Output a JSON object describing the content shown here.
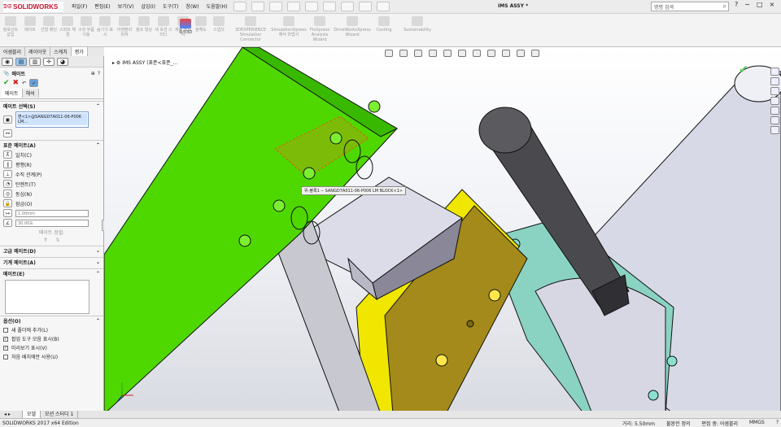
{
  "app": {
    "logo": "SOLIDWORKS",
    "doc_title": "IMS ASSY *"
  },
  "menu": [
    "파일(F)",
    "편집(E)",
    "보기(V)",
    "삽입(I)",
    "도구(T)",
    "창(W)",
    "도움말(H)"
  ],
  "search": {
    "placeholder": "명령 검색"
  },
  "window_controls": [
    "?",
    "−",
    "□",
    "×"
  ],
  "ribbon": {
    "buttons": [
      {
        "label": "컴포넌트 삽입",
        "enabled": false
      },
      {
        "label": "메이트",
        "enabled": false
      },
      {
        "label": "선형 패턴",
        "enabled": false
      },
      {
        "label": "스마트 체결",
        "enabled": false
      },
      {
        "label": "구성 부품 이동",
        "enabled": false
      },
      {
        "label": "숨기기 표시",
        "enabled": false
      },
      {
        "label": "어셈블리 피처",
        "enabled": false
      },
      {
        "label": "참조 형상",
        "enabled": false
      },
      {
        "label": "새 모션 스터디",
        "enabled": false
      },
      {
        "label": "재질 명세서",
        "enabled": false
      },
      {
        "label": "분해도",
        "enabled": false
      },
      {
        "label": "즉각3D",
        "enabled": true
      },
      {
        "label": "스냅샷",
        "enabled": false
      },
      {
        "label": "3DEXPERIENCE Simulation Connector",
        "enabled": false
      },
      {
        "label": "SimulationXpress 해석 마법사",
        "enabled": false
      },
      {
        "label": "FloXpress Analysis Wizard",
        "enabled": false
      },
      {
        "label": "DriveWorksXpress Wizard",
        "enabled": false
      },
      {
        "label": "Costing",
        "enabled": false
      },
      {
        "label": "Sustainability",
        "enabled": false
      }
    ]
  },
  "left_tabs": [
    "어셈블리",
    "레이아웃",
    "스케치",
    "평가"
  ],
  "panel": {
    "title": "메이트",
    "subtabs": [
      "메이트",
      "해석"
    ],
    "mate_selection_header": "메이트 선택(S)",
    "selected_item": "면<1>@SANGD7A011-06-P006 LM...",
    "standard_mates_header": "표준 메이트(A)",
    "mates": [
      "일치(C)",
      "평행(R)",
      "수직 관계(P)",
      "탄젠트(T)",
      "동심(N)",
      "잠금(O)"
    ],
    "distance_value": "1.00mm",
    "angle_value": "30.00도",
    "mate_align_label": "메이트 정렬:",
    "advanced_header": "고급 메이트(D)",
    "mechanical_header": "기계 메이트(A)",
    "mates_list_header": "메이트(E)",
    "options_header": "옵션(O)",
    "options": [
      {
        "label": "새 폴더에 추가(L)",
        "checked": false
      },
      {
        "label": "팝업 도구 모음 표시(B)",
        "checked": true
      },
      {
        "label": "미리보기 표시(V)",
        "checked": true
      },
      {
        "label": "처음 배치에만 사용(U)",
        "checked": false
      }
    ]
  },
  "viewport": {
    "tree_root": "IMS ASSY (표준<표준_...",
    "tooltip": "위-볼록1 -- SANGD7A011-06-P006 LM BLOCK<1>"
  },
  "bottom_tabs": [
    "모델",
    "모션 스터디 1"
  ],
  "status": {
    "edition": "SOLIDWORKS 2017 x64 Edition",
    "distance": "거리: 5.50mm",
    "under_defined": "불완전 정의",
    "editing": "편집 중: 어셈블리",
    "units": "MMGS"
  }
}
